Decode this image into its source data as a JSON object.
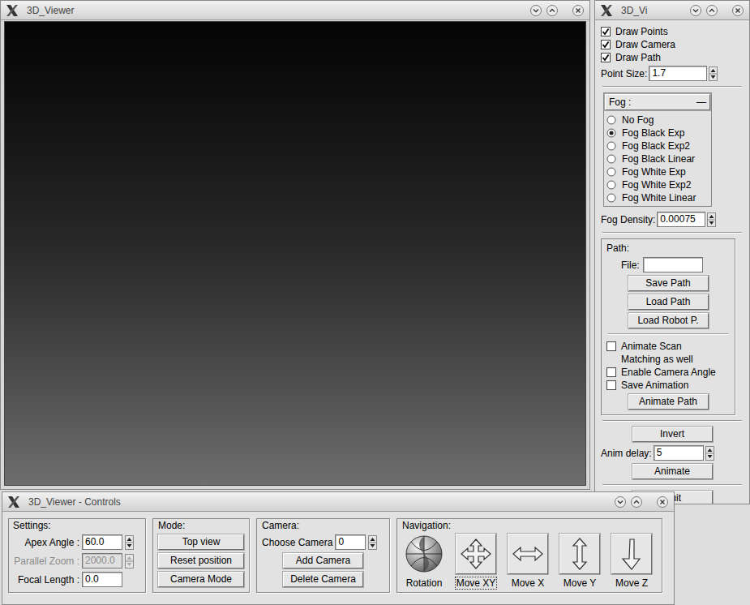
{
  "viewer": {
    "title": "3D_Viewer"
  },
  "side": {
    "title": "3D_Vi",
    "checkboxes": [
      {
        "label": "Draw Points",
        "checked": true
      },
      {
        "label": "Draw Camera",
        "checked": true
      },
      {
        "label": "Draw Path",
        "checked": true
      }
    ],
    "point_size": {
      "label": "Point Size:",
      "value": "1.7"
    },
    "fog": {
      "title": "Fog :",
      "collapse": "—",
      "options": [
        {
          "label": "No Fog",
          "selected": false
        },
        {
          "label": "Fog Black Exp",
          "selected": true
        },
        {
          "label": "Fog Black Exp2",
          "selected": false
        },
        {
          "label": "Fog Black Linear",
          "selected": false
        },
        {
          "label": "Fog White Exp",
          "selected": false
        },
        {
          "label": "Fog White Exp2",
          "selected": false
        },
        {
          "label": "Fog White Linear",
          "selected": false
        }
      ]
    },
    "fog_density": {
      "label": "Fog Density:",
      "value": "0.00075"
    },
    "path": {
      "title": "Path:",
      "file_label": "File:",
      "file_value": "",
      "buttons": [
        "Save Path",
        "Load Path",
        "Load Robot P."
      ],
      "options": [
        {
          "label_lines": [
            "Animate Scan",
            "Matching as well"
          ],
          "checked": false
        },
        {
          "label_lines": [
            "Enable Camera Angle"
          ],
          "checked": false
        },
        {
          "label_lines": [
            "Save Animation"
          ],
          "checked": false
        }
      ],
      "animate_path": "Animate Path"
    },
    "invert": "Invert",
    "anim_delay": {
      "label": "Anim delay:",
      "value": "5"
    },
    "animate": "Animate",
    "quit": "Quit"
  },
  "controls": {
    "title": "3D_Viewer - Controls",
    "settings": {
      "title": "Settings:",
      "fields": [
        {
          "label": "Apex Angle :",
          "value": "60.0",
          "spinner": true,
          "disabled": false
        },
        {
          "label": "Parallel Zoom :",
          "value": "2000.0",
          "spinner": true,
          "disabled": true
        },
        {
          "label": "Focal Length :",
          "value": "0.0",
          "spinner": false,
          "disabled": false
        }
      ]
    },
    "mode": {
      "title": "Mode:",
      "buttons": [
        "Top view",
        "Reset position",
        "Camera Mode"
      ]
    },
    "camera": {
      "title": "Camera:",
      "choose_label": "Choose Camera",
      "choose_value": "0",
      "buttons": [
        "Add Camera",
        "Delete Camera"
      ]
    },
    "navigation": {
      "title": "Navigation:",
      "tools": [
        {
          "label": "Rotation",
          "selected": false,
          "kind": "ball"
        },
        {
          "label": "Move XY",
          "selected": true,
          "kind": "cross"
        },
        {
          "label": "Move X",
          "selected": false,
          "kind": "horizontal"
        },
        {
          "label": "Move Y",
          "selected": false,
          "kind": "vertical"
        },
        {
          "label": "Move Z",
          "selected": false,
          "kind": "depth"
        }
      ]
    }
  }
}
